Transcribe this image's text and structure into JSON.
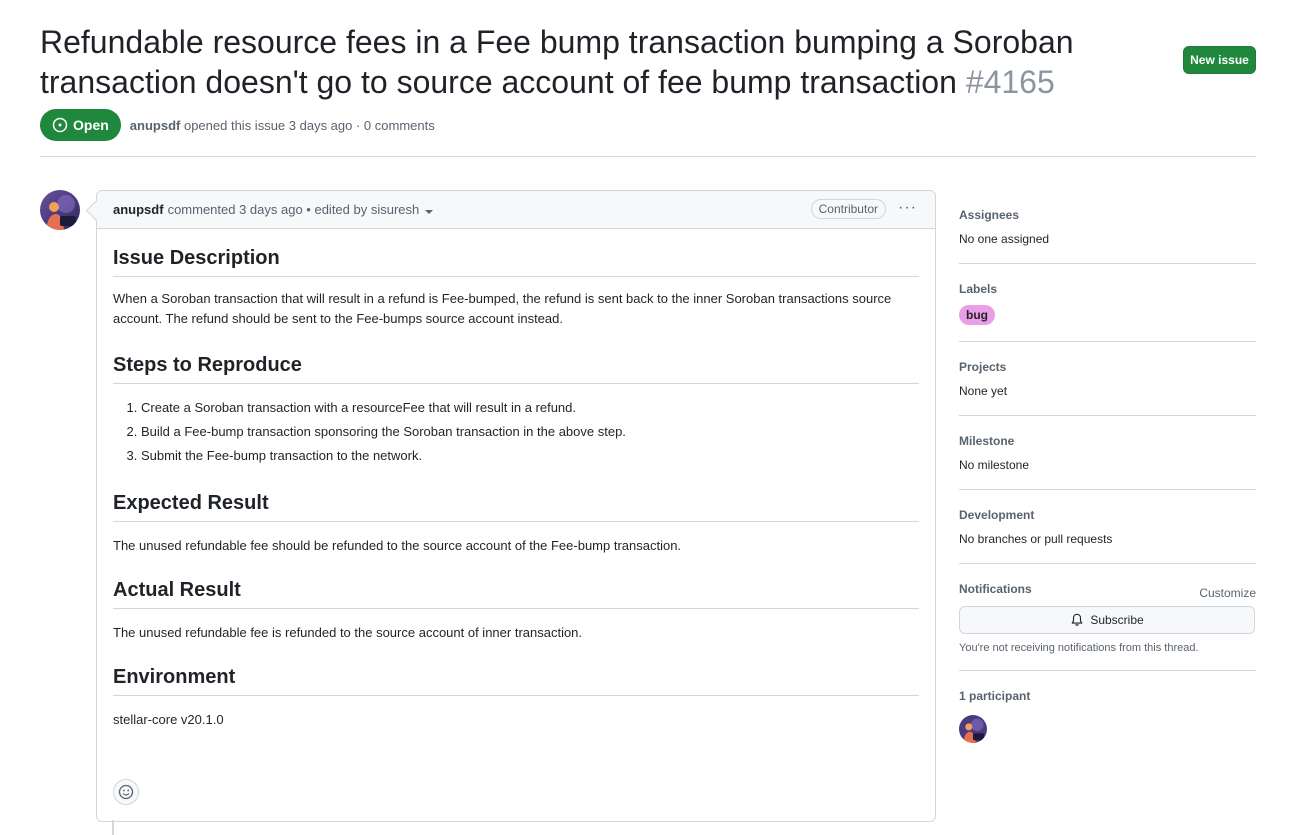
{
  "issue": {
    "title": "Refundable resource fees in a Fee bump transaction bumping a Soroban transaction doesn't go to source account of fee bump transaction",
    "number": "#4165",
    "status": "Open",
    "author": "anupsdf",
    "opened_text": "opened this issue 3 days ago · 0 comments"
  },
  "header": {
    "new_issue_label": "New issue"
  },
  "comment": {
    "author": "anupsdf",
    "meta": "commented 3 days ago • edited by sisuresh",
    "badge": "Contributor",
    "menu": "···",
    "sections": [
      {
        "heading": "Issue Description",
        "text": "When a Soroban transaction that will result in a refund is Fee-bumped, the refund is sent back to the inner Soroban transactions source account. The refund should be sent to the Fee-bumps source account instead."
      },
      {
        "heading": "Steps to Reproduce",
        "steps": [
          "Create a Soroban transaction with a resourceFee that will result in a refund.",
          "Build a Fee-bump transaction sponsoring the Soroban transaction in the above step.",
          "Submit the Fee-bump transaction to the network."
        ]
      },
      {
        "heading": "Expected Result",
        "text": "The unused refundable fee should be refunded to the source account of the Fee-bump transaction."
      },
      {
        "heading": "Actual Result",
        "text": "The unused refundable fee is refunded to the source account of inner transaction."
      },
      {
        "heading": "Environment",
        "text": "stellar-core v20.1.0"
      }
    ]
  },
  "sidebar": {
    "assignees": {
      "heading": "Assignees",
      "value": "No one assigned"
    },
    "labels": {
      "heading": "Labels",
      "value": "bug",
      "color": "#e99ee6"
    },
    "projects": {
      "heading": "Projects",
      "value": "None yet"
    },
    "milestone": {
      "heading": "Milestone",
      "value": "No milestone"
    },
    "development": {
      "heading": "Development",
      "value": "No branches or pull requests"
    },
    "notifications": {
      "heading": "Notifications",
      "customize": "Customize",
      "subscribe": "Subscribe",
      "note": "You're not receiving notifications from this thread."
    },
    "participants": {
      "heading": "1 participant"
    }
  },
  "colors": {
    "open_green": "#1f883d",
    "border": "#d0d7de",
    "muted": "#59636e"
  }
}
